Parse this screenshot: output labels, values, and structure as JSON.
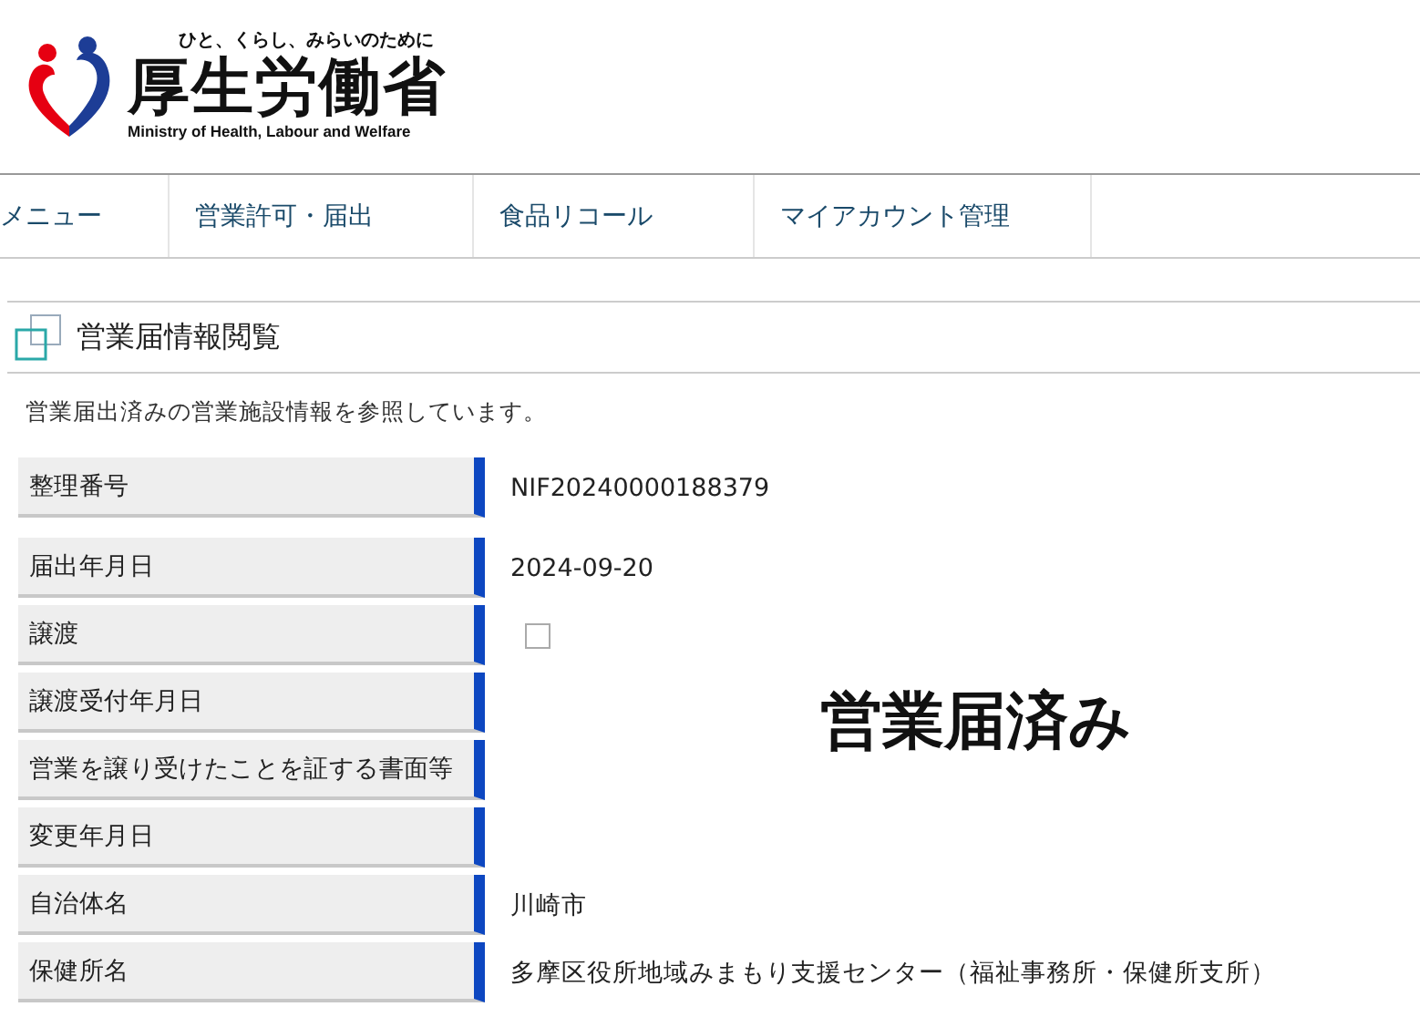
{
  "logo": {
    "tagline": "ひと、くらし、みらいのために",
    "name": "厚生労働省",
    "english": "Ministry of Health, Labour and Welfare"
  },
  "nav": [
    {
      "label": "メニュー"
    },
    {
      "label": "営業許可・届出"
    },
    {
      "label": "食品リコール"
    },
    {
      "label": "マイアカウント管理"
    }
  ],
  "page": {
    "title": "営業届情報閲覧",
    "description": "営業届出済みの営業施設情報を参照しています。",
    "stamp": "営業届済み"
  },
  "fields": [
    {
      "kind": "text",
      "label": "整理番号",
      "value": "NIF20240000188379"
    },
    {
      "kind": "text",
      "label": "届出年月日",
      "value": "2024-09-20"
    },
    {
      "kind": "checkbox",
      "label": "譲渡",
      "checked": false
    },
    {
      "kind": "text",
      "label": "譲渡受付年月日"
    },
    {
      "kind": "text",
      "label": "営業を譲り受けたことを証する書面等"
    },
    {
      "kind": "text",
      "label": "変更年月日"
    },
    {
      "kind": "text",
      "label": "自治体名",
      "value": "川崎市"
    },
    {
      "kind": "text",
      "label": "保健所名",
      "value": "多摩区役所地域みまもり支援センター（福祉事務所・保健所支所）"
    }
  ]
}
